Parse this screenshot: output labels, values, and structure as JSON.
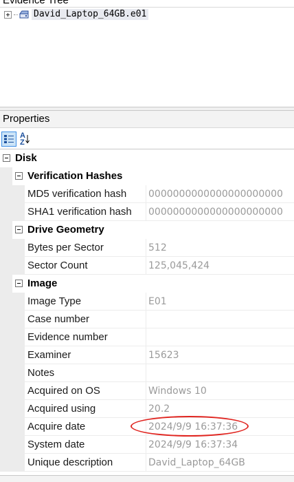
{
  "evidence_tree": {
    "title": "Evidence Tree",
    "items": [
      {
        "label": "David_Laptop_64GB.e01",
        "icon": "disk-image-icon",
        "expanded": false
      }
    ]
  },
  "properties": {
    "title": "Properties",
    "toolbar": {
      "categorized_icon": "categorized-view-icon",
      "sort_icon": "sort-alphabetical-icon",
      "sort_label_a": "A",
      "sort_label_z": "Z"
    },
    "root": {
      "label": "Disk"
    },
    "categories": [
      {
        "label": "Verification Hashes",
        "rows": [
          {
            "name": "MD5 verification hash",
            "value": "0000000000000000000000"
          },
          {
            "name": "SHA1 verification hash",
            "value": "0000000000000000000000"
          }
        ]
      },
      {
        "label": "Drive Geometry",
        "rows": [
          {
            "name": "Bytes per Sector",
            "value": "512"
          },
          {
            "name": "Sector Count",
            "value": "125,045,424"
          }
        ]
      },
      {
        "label": "Image",
        "rows": [
          {
            "name": "Image Type",
            "value": "E01"
          },
          {
            "name": "Case number",
            "value": ""
          },
          {
            "name": "Evidence number",
            "value": ""
          },
          {
            "name": "Examiner",
            "value": "15623"
          },
          {
            "name": "Notes",
            "value": ""
          },
          {
            "name": "Acquired on OS",
            "value": "Windows 10"
          },
          {
            "name": "Acquired using",
            "value": "20.2"
          },
          {
            "name": "Acquire date",
            "value": "2024/9/9 16:37:36"
          },
          {
            "name": "System date",
            "value": "2024/9/9 16:37:34"
          },
          {
            "name": "Unique description",
            "value": "David_Laptop_64GB"
          }
        ]
      }
    ],
    "highlight_color": "#e0241f"
  }
}
